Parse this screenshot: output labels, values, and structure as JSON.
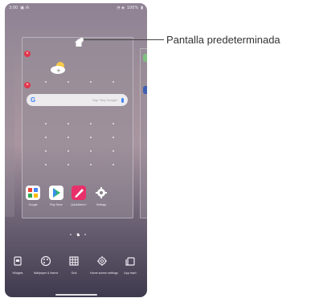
{
  "statusbar": {
    "time": "3:00",
    "right_info": "100%"
  },
  "callout": {
    "label": "Pantalla predeterminada"
  },
  "search": {
    "placeholder": "Say \"Hey Google\""
  },
  "apps": [
    {
      "label": "Google",
      "icon": "google-folder-icon"
    },
    {
      "label": "Play Store",
      "icon": "play-store-icon"
    },
    {
      "label": "QuickMemo+",
      "icon": "quickmemo-icon"
    },
    {
      "label": "Settings",
      "icon": "settings-gear-icon"
    }
  ],
  "toolbar": [
    {
      "label": "Widgets",
      "icon": "widgets-icon"
    },
    {
      "label": "Wallpaper & theme",
      "icon": "palette-icon"
    },
    {
      "label": "Grid",
      "icon": "grid-icon"
    },
    {
      "label": "Home screen settings",
      "icon": "settings-icon"
    },
    {
      "label": "App trash",
      "icon": "app-trash-icon"
    }
  ],
  "colors": {
    "delete_badge": "#e2344b",
    "google_blue": "#4285f4"
  }
}
